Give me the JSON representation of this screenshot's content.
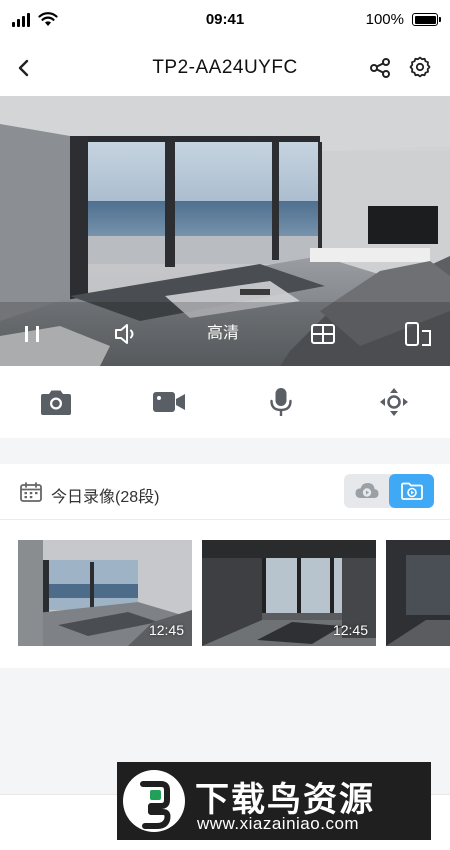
{
  "status_bar": {
    "time": "09:41",
    "battery": "100%"
  },
  "nav": {
    "title": "TP2-AA24UYFC",
    "back_icon": "chevron-left-icon",
    "share_icon": "share-icon",
    "settings_icon": "gear-icon"
  },
  "video_controls": {
    "quality_label": "高清"
  },
  "recordings": {
    "title": "今日录像(28段)",
    "active_source": "local",
    "items": [
      {
        "duration": "12:45"
      },
      {
        "duration": "12:45"
      },
      {
        "duration": ""
      }
    ]
  },
  "watermark": {
    "title": "下载鸟资源",
    "url": "www.xiazainiao.com"
  },
  "colors": {
    "accent": "#3fa9f5",
    "icon": "#5a5f66"
  }
}
